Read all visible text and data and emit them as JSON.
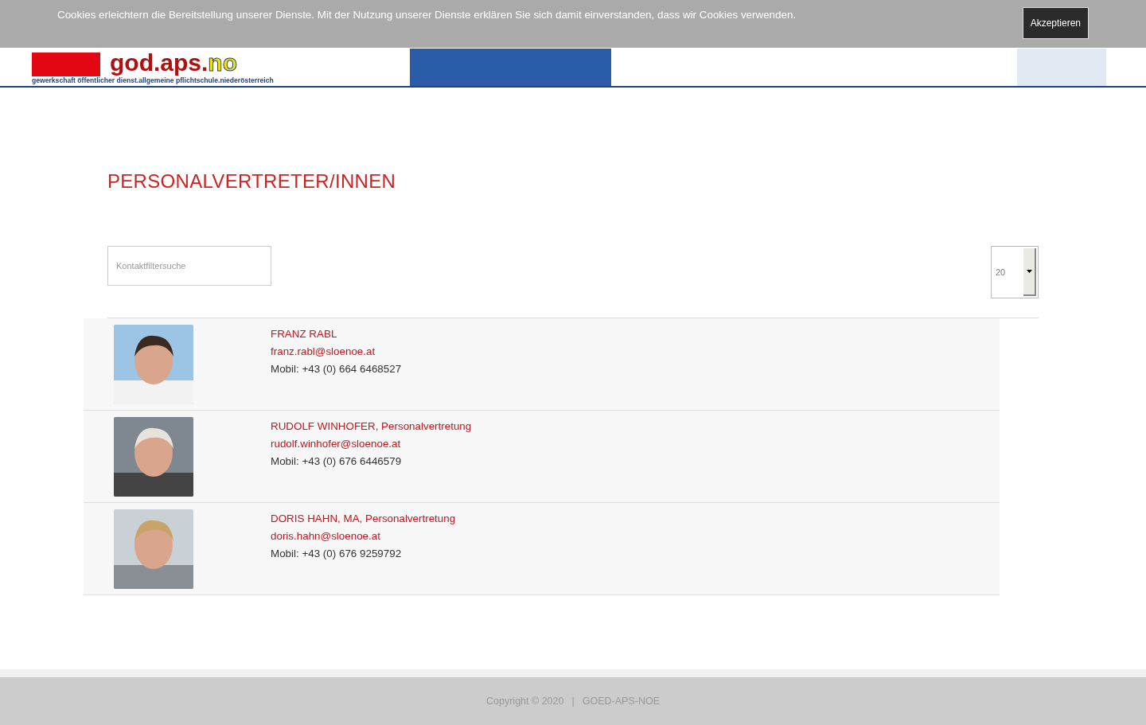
{
  "cookie_banner": {
    "message": "Cookies erleichtern die Bereitstellung unserer Dienste. Mit der Nutzung unserer Dienste erklären Sie sich damit einverstanden, dass wir Cookies verwenden.",
    "button": "Akzeptieren"
  },
  "header": {
    "logo": {
      "name": "god.aps.",
      "suffix": "no",
      "tagline": "gewerkschaft öffentlicher dienst.allgemeine pflichtschule.niederösterreich"
    }
  },
  "page": {
    "title": "PERSONALVERTRETER/INNEN",
    "search": {
      "placeholder": "Kontaktfiltersuche"
    },
    "page_size": {
      "value": "20"
    }
  },
  "contacts": [
    {
      "name": "FRANZ RABL",
      "email": "franz.rabl@sloenoe.at",
      "phone": "Mobil: +43 (0) 664 6468527"
    },
    {
      "name": "RUDOLF WINHOFER, Personalvertretung",
      "email": "rudolf.winhofer@sloenoe.at",
      "phone": "Mobil: +43 (0) 676 6446579"
    },
    {
      "name": "DORIS HAHN, MA, Personalvertretung",
      "email": "doris.hahn@sloenoe.at",
      "phone": "Mobil: +43 (0) 676 9259792"
    }
  ],
  "footer": {
    "copyright": "Copyright © 2020",
    "separator": "|",
    "site": "GOED-APS-NOE"
  }
}
